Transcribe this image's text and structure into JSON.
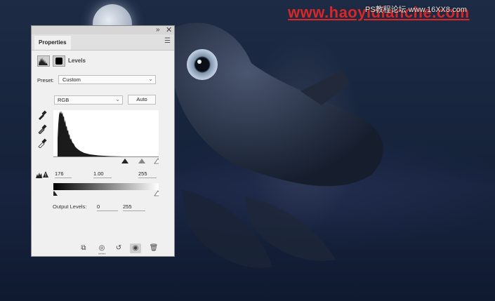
{
  "watermark": {
    "main_text": "www.haoyidianche.com",
    "secondary_text": "PS教程论坛 www.16XX8.com"
  },
  "panel": {
    "tab_label": "Properties",
    "title": "Levels",
    "preset_label": "Preset:",
    "preset_value": "Custom",
    "channel_value": "RGB",
    "auto_label": "Auto",
    "input_levels": {
      "black": "176",
      "gamma": "1.00",
      "white": "255"
    },
    "output_levels": {
      "label": "Output Levels:",
      "black": "0",
      "white": "255"
    }
  },
  "footer_icons": [
    "clip-to-layer-icon",
    "view-previous-state-icon",
    "reset-icon",
    "visibility-eye-icon",
    "delete-trash-icon"
  ],
  "colors": {
    "panel_bg": "#f0f0f0",
    "watermark_red": "#d92626",
    "scene_dark_blue": "#17233a"
  }
}
